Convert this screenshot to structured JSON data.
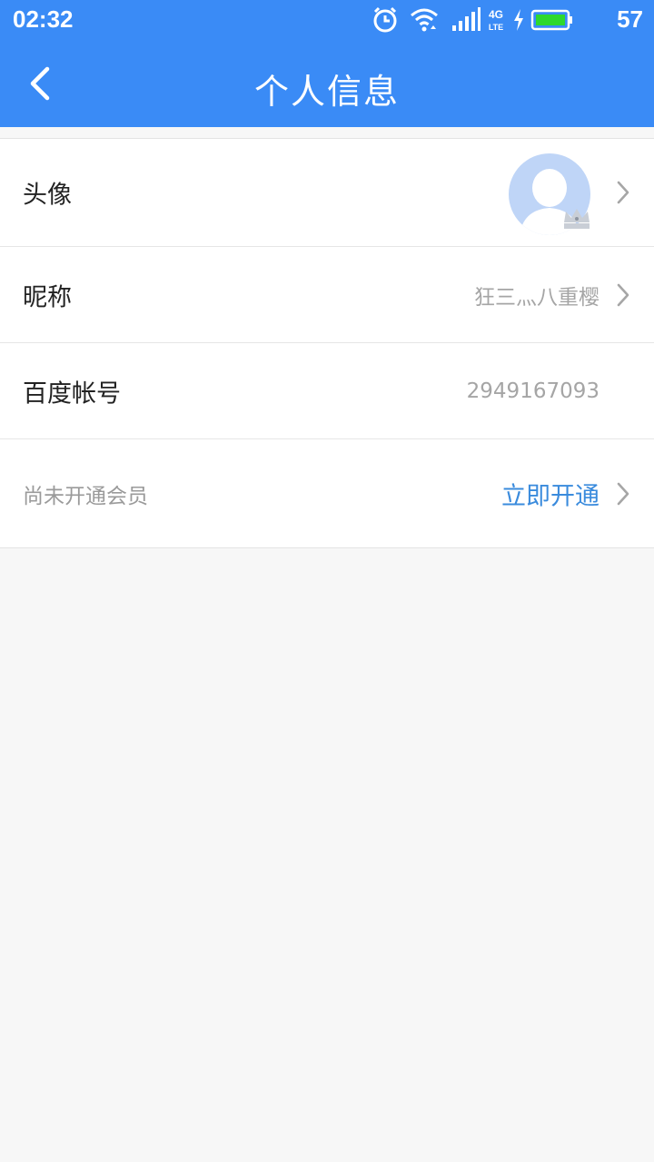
{
  "status_bar": {
    "time": "02:32",
    "battery": "57",
    "network": "4G LTE",
    "icons": [
      "alarm-icon",
      "wifi-icon",
      "signal-icon",
      "network-4g-icon",
      "charging-icon",
      "battery-icon"
    ]
  },
  "header": {
    "title": "个人信息",
    "back_icon": "chevron-left-icon"
  },
  "rows": {
    "avatar": {
      "label": "头像"
    },
    "nickname": {
      "label": "昵称",
      "value": "狂三灬八重樱"
    },
    "account": {
      "label": "百度帐号",
      "value": "2949167093"
    },
    "vip": {
      "label": "尚未开通会员",
      "action": "立即开通"
    }
  },
  "colors": {
    "primary": "#3a8bf6",
    "link": "#3a8bdd",
    "background": "#f7f7f7"
  }
}
